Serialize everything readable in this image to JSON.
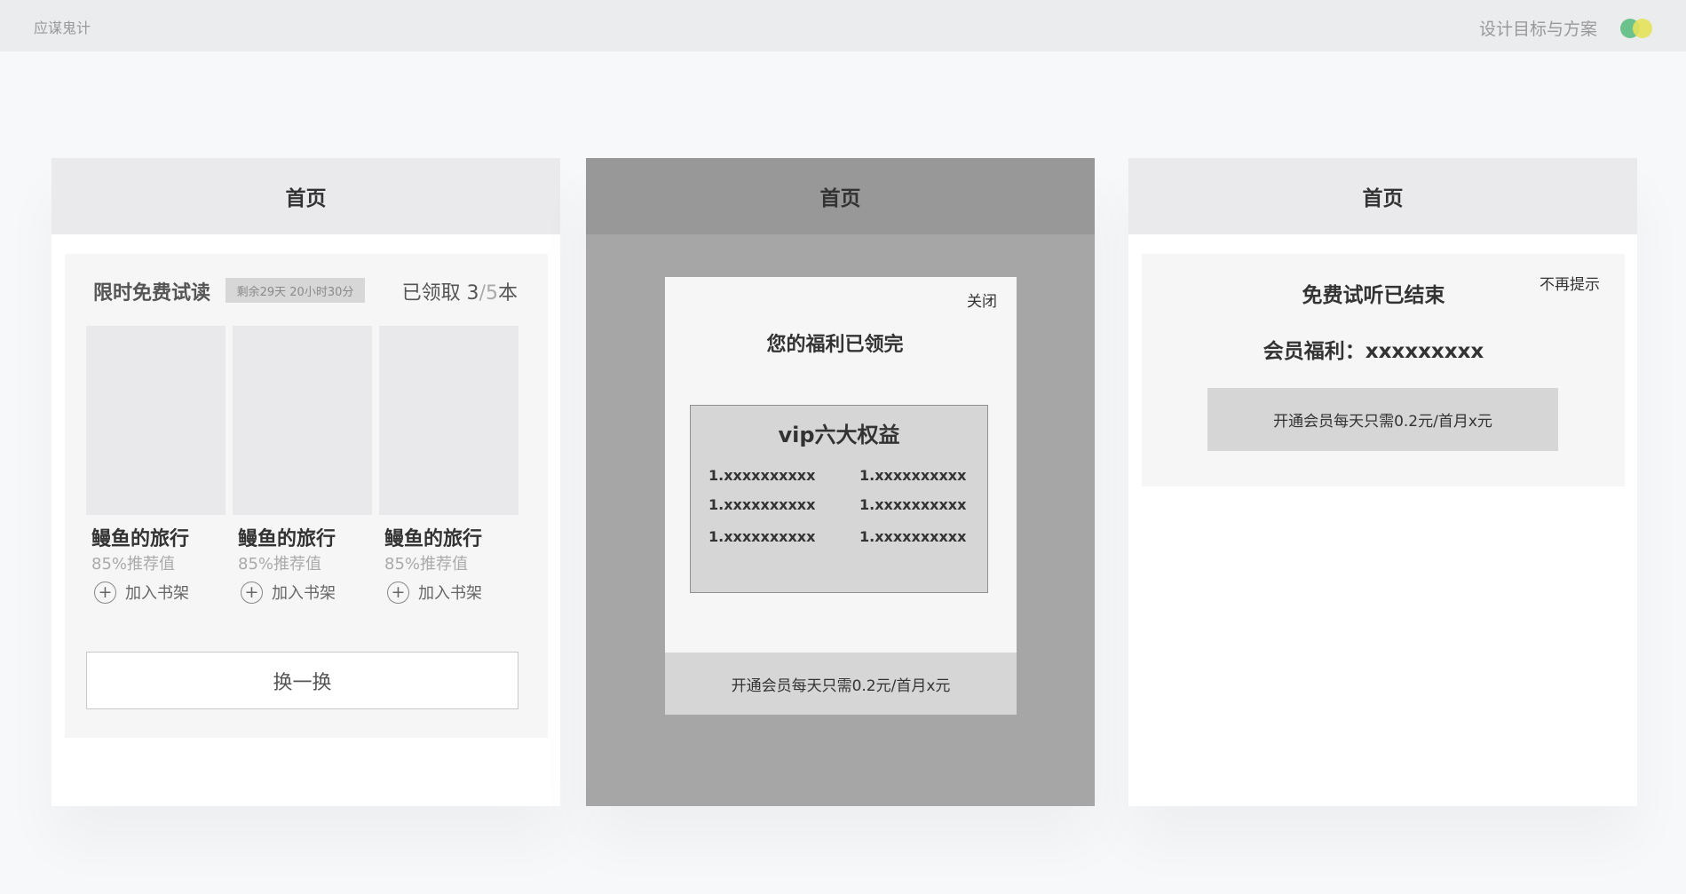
{
  "topbar": {
    "brand": "应谋鬼计",
    "title": "设计目标与方案",
    "logo_colors": [
      "#6cc28d",
      "#e6e25a"
    ]
  },
  "panel1": {
    "header": "首页",
    "section_title": "限时免费试读",
    "countdown": "剩余29天 20小时30分",
    "claimed_prefix": "已领取 3",
    "claimed_total": "/5",
    "claimed_suffix": "本",
    "books": [
      {
        "name": "鳗鱼的旅行",
        "score": "85%推荐值",
        "add_label": "加入书架"
      },
      {
        "name": "鳗鱼的旅行",
        "score": "85%推荐值",
        "add_label": "加入书架"
      },
      {
        "name": "鳗鱼的旅行",
        "score": "85%推荐值",
        "add_label": "加入书架"
      }
    ],
    "swap_label": "换一换"
  },
  "panel2": {
    "header": "首页",
    "modal": {
      "close_label": "关闭",
      "title": "您的福利已领完",
      "vip_title": "vip六大权益",
      "vip_items": [
        "1.xxxxxxxxxx",
        "1.xxxxxxxxxx",
        "1.xxxxxxxxxx",
        "1.xxxxxxxxxx",
        "1.xxxxxxxxxx",
        "1.xxxxxxxxxx"
      ],
      "footer_cta": "开通会员每天只需0.2元/首月x元"
    }
  },
  "panel3": {
    "header": "首页",
    "no_remind": "不再提示",
    "title": "免费试听已结束",
    "benefit": "会员福利：xxxxxxxxx",
    "cta": "开通会员每天只需0.2元/首月x元"
  }
}
